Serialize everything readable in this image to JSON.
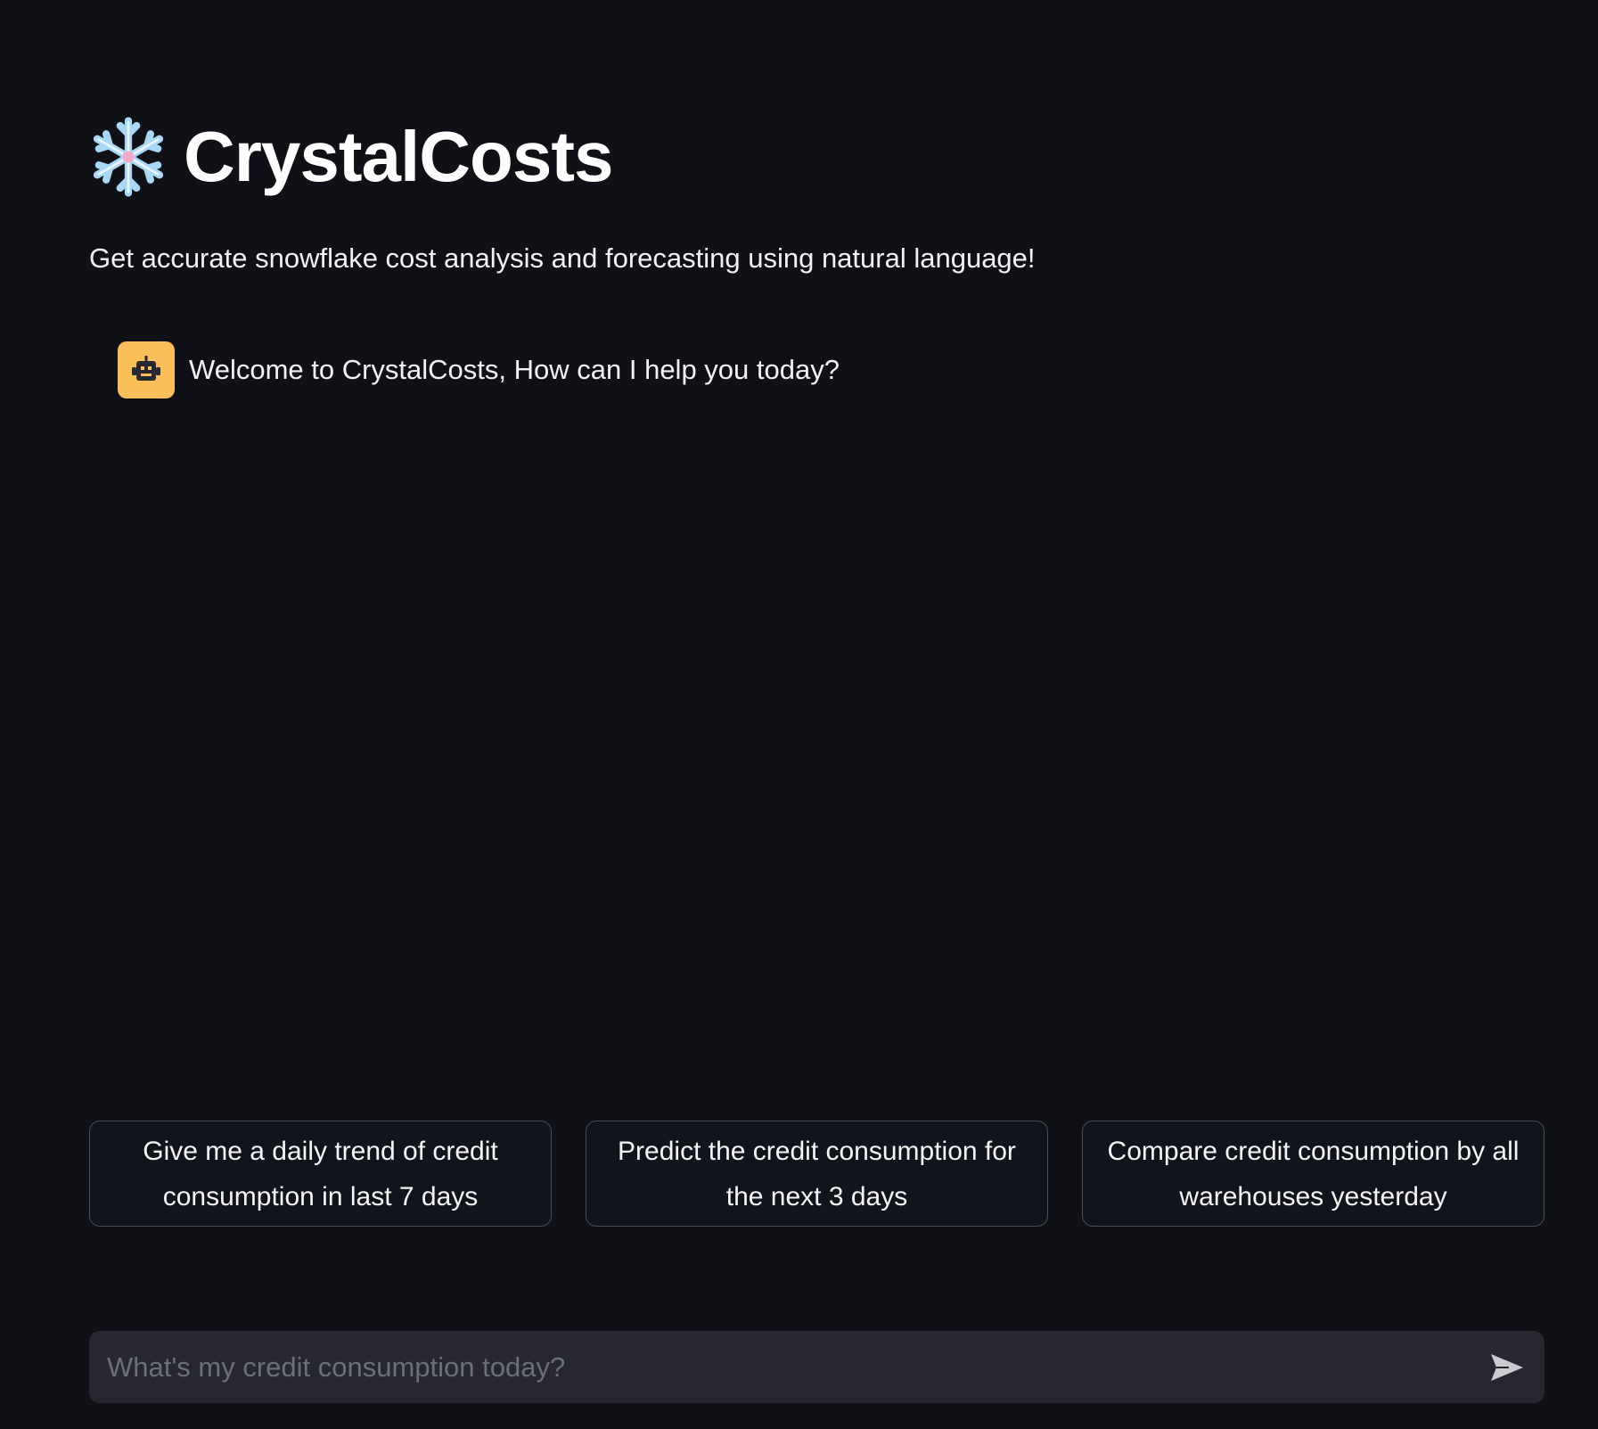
{
  "header": {
    "title": "CrystalCosts",
    "subtitle": "Get accurate snowflake cost analysis and forecasting using natural language!",
    "title_icon": "snowflake-icon"
  },
  "chat": {
    "messages": [
      {
        "role": "assistant",
        "avatar_icon": "robot-icon",
        "text": "Welcome to CrystalCosts, How can I help you today?"
      }
    ]
  },
  "suggestions": [
    {
      "label": "Give me a daily trend of credit consumption in last 7 days"
    },
    {
      "label": "Predict the credit consumption for the next 3 days"
    },
    {
      "label": "Compare credit consumption by all warehouses yesterday"
    }
  ],
  "input": {
    "placeholder": "What's my credit consumption today?",
    "value": "",
    "send_icon": "send-icon"
  },
  "colors": {
    "background": "#0f1117",
    "avatar": "#fbbf5a",
    "input_background": "#262730",
    "button_border": "#4a4d57"
  }
}
